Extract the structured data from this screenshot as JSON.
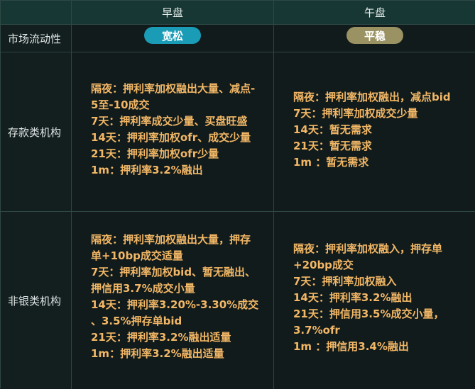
{
  "header": {
    "col1": "早盘",
    "col2": "午盘"
  },
  "rows": {
    "liquidity": {
      "label": "市场流动性",
      "morning": "宽松",
      "afternoon": "平稳"
    },
    "deposit": {
      "label": "存款类机构",
      "morning": [
        "隔夜：押利率加权融出大量、减点-",
        "5至-10成交",
        "7天：押利率成交少量、买盘旺盛",
        "14天：押利率加权ofr、成交少量",
        "21天：押利率加权ofr少量",
        "1m：押利率3.2%融出"
      ],
      "afternoon": [
        "隔夜：押利率加权融出，减点bid",
        "7天：押利率加权成交少量",
        "14天：暂无需求",
        "21天：暂无需求",
        "1m ：暂无需求"
      ]
    },
    "nonbank": {
      "label": "非银类机构",
      "morning": [
        "隔夜：押利率加权融出大量，押存",
        "单+10bp成交适量",
        "7天：押利率加权bid、暂无融出、",
        "押信用3.7%成交小量",
        "14天：押利率3.20%-3.30%成交",
        "、3.5%押存单bid",
        "21天：押利率3.2%融出适量",
        "1m：押利率3.2%融出适量"
      ],
      "afternoon": [
        "隔夜：押利率加权融入，押存单",
        "+20bp成交",
        "7天：押利率加权融入",
        "14天：押利率3.2%融出",
        "21天：押信用3.5%成交小量，",
        "3.7%ofr",
        "1m ：押信用3.4%融出"
      ]
    }
  },
  "colors": {
    "pill_blue": "#1a9bb6",
    "pill_olive": "#9a9262",
    "text_orange": "#f2b766"
  }
}
